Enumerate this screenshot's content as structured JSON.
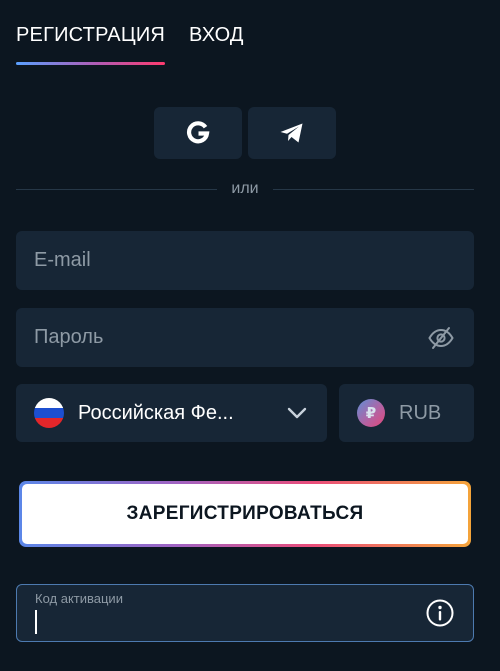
{
  "tabs": [
    {
      "label": "РЕГИСТРАЦИЯ",
      "active": true
    },
    {
      "label": "ВХОД",
      "active": false
    }
  ],
  "social": [
    {
      "name": "google",
      "icon": "google-icon"
    },
    {
      "name": "telegram",
      "icon": "telegram-icon"
    }
  ],
  "divider": {
    "text": "или"
  },
  "email": {
    "placeholder": "E-mail",
    "value": ""
  },
  "password": {
    "placeholder": "Пароль",
    "value": "",
    "toggle_icon": "eye-off-icon"
  },
  "country": {
    "label": "Российская Фе...",
    "icon": "flag-russia-icon",
    "chevron_icon": "chevron-down-icon"
  },
  "currency": {
    "label": "RUB",
    "symbol": "₽"
  },
  "register": {
    "label": "ЗАРЕГИСТРИРОВАТЬСЯ"
  },
  "activation": {
    "label": "Код активации",
    "value": "",
    "info_icon": "info-icon"
  },
  "colors": {
    "background": "#0c1620",
    "field": "#172636",
    "muted_text": "#8e9aa5",
    "accent_blue": "#5aa0ff",
    "accent_pink": "#ff3b6e",
    "accent_orange": "#f4a43a"
  }
}
